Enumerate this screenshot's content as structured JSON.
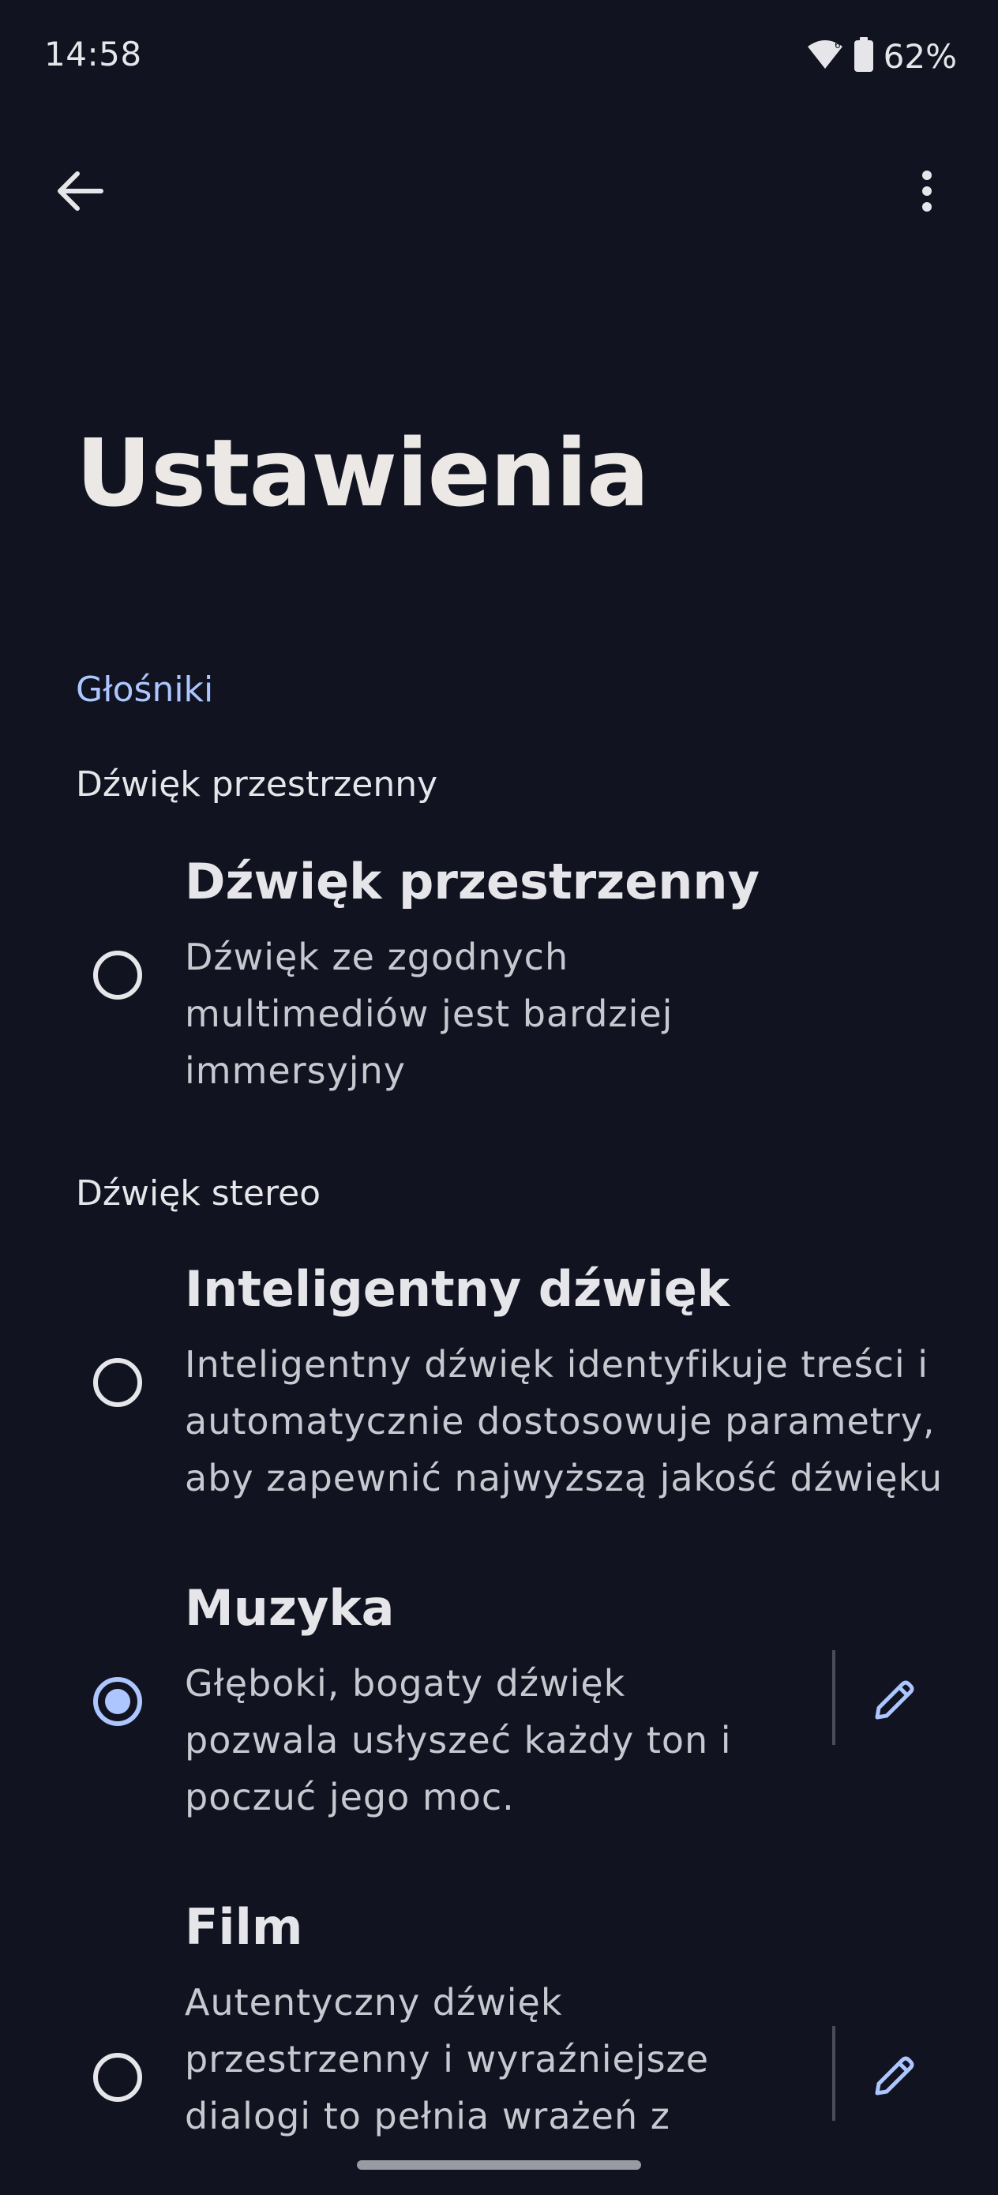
{
  "status_bar": {
    "time": "14:58",
    "battery": "62%",
    "icons": [
      "wifi-icon",
      "battery-icon"
    ]
  },
  "app_bar": {
    "back_icon": "arrow-back-icon",
    "more_icon": "more-vert-icon"
  },
  "title": "Ustawienia",
  "section": "Głośniki",
  "groups": {
    "spatial_label": "Dźwięk przestrzenny",
    "stereo_label": "Dźwięk stereo"
  },
  "options": [
    {
      "title": "Dźwięk przestrzenny",
      "desc": [
        "Dźwięk ze zgodnych",
        "multimediów jest bardziej",
        "immersyjny"
      ],
      "selected": false
    },
    {
      "title": "Inteligentny dźwięk",
      "desc": [
        "Inteligentny dźwięk identyfikuje treści i",
        "automatycznie dostosowuje parametry,",
        "aby zapewnić najwyższą jakość dźwięku"
      ],
      "selected": false
    },
    {
      "title": "Muzyka",
      "desc": [
        "Głęboki, bogaty dźwięk",
        "pozwala usłyszeć każdy ton i",
        "poczuć jego moc."
      ],
      "selected": true,
      "editable": true
    },
    {
      "title": "Film",
      "desc": [
        "Autentyczny dźwięk",
        "przestrzenny i wyraźniejsze",
        "dialogi to pełnia wrażeń z"
      ],
      "selected": false,
      "editable": true
    }
  ],
  "colors": {
    "background": "#111420",
    "accent": "#adc6ff",
    "text": "#e6e6ea"
  }
}
